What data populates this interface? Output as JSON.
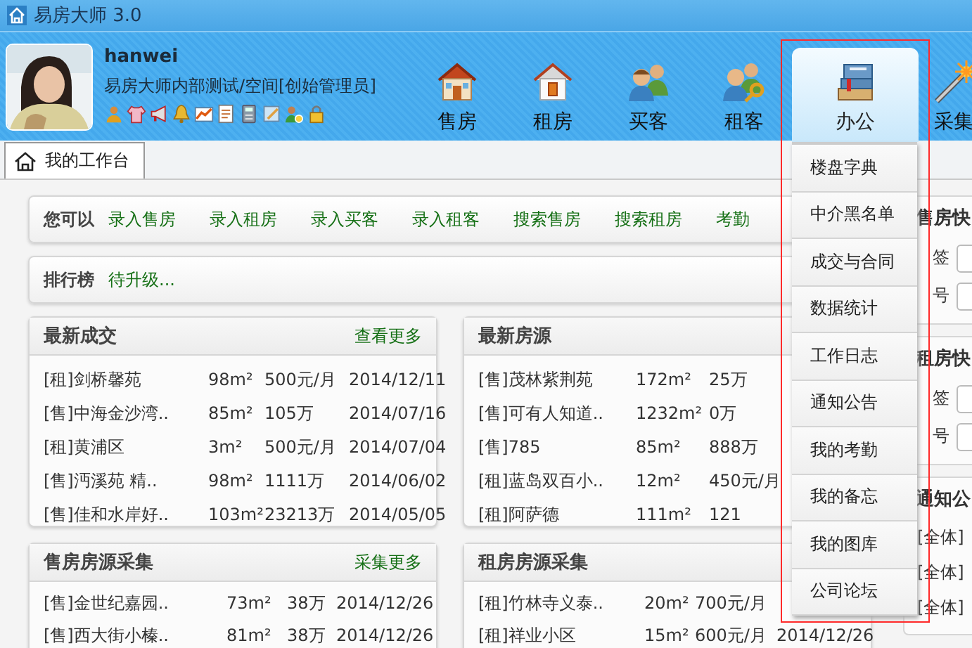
{
  "window": {
    "title": "易房大师 3.0"
  },
  "user": {
    "name": "hanwei",
    "org": "易房大师内部测试/空间[创始管理员]"
  },
  "nav": [
    {
      "label": "售房",
      "selected": false
    },
    {
      "label": "租房",
      "selected": false
    },
    {
      "label": "买客",
      "selected": false
    },
    {
      "label": "租客",
      "selected": false
    },
    {
      "label": "办公",
      "selected": true
    },
    {
      "label": "采集",
      "selected": false
    }
  ],
  "tabs": [
    {
      "label": "我的工作台",
      "selected": true
    }
  ],
  "quick_actions": {
    "label": "您可以",
    "links": [
      "录入售房",
      "录入租房",
      "录入买客",
      "录入租客",
      "搜索售房",
      "搜索租房",
      "考勤"
    ]
  },
  "ranking": {
    "label": "排行榜",
    "value": "待升级..."
  },
  "cards": [
    {
      "title": "最新成交",
      "more": "查看更多",
      "rows": [
        [
          "[租]剑桥馨苑",
          "98m²",
          "500元/月",
          "2014/12/11"
        ],
        [
          "[售]中海金沙湾..",
          "85m²",
          "105万",
          "2014/07/16"
        ],
        [
          "[租]黄浦区",
          "3m²",
          "500元/月",
          "2014/07/04"
        ],
        [
          "[售]沔溪苑 精..",
          "98m²",
          "1111万",
          "2014/06/02"
        ],
        [
          "[售]佳和水岸好..",
          "103m²",
          "23213万",
          "2014/05/05"
        ]
      ]
    },
    {
      "title": "最新房源",
      "rows": [
        [
          "[售]茂林紫荆苑",
          "172m²",
          "25万"
        ],
        [
          "[售]可有人知道..",
          "1232m²",
          "0万"
        ],
        [
          "[售]785",
          "85m²",
          "888万"
        ],
        [
          "[租]蓝岛双百小..",
          "12m²",
          "450元/月"
        ],
        [
          "[租]阿萨德",
          "111m²",
          "121"
        ]
      ]
    },
    {
      "title": "售房房源采集",
      "more": "采集更多",
      "rows": [
        [
          "[售]金世纪嘉园..",
          "73m²",
          "38万",
          "2014/12/26"
        ],
        [
          "[售]西大街小榛..",
          "81m²",
          "38万",
          "2014/12/26"
        ]
      ]
    },
    {
      "title": "租房房源采集",
      "rows": [
        [
          "[租]竹林寺义泰..",
          "20m²",
          "700元/月"
        ],
        [
          "[租]祥业小区",
          "15m²",
          "600元/月",
          "2014/12/26"
        ]
      ]
    }
  ],
  "side_cards": [
    {
      "title": "售房快",
      "fields": [
        "签",
        "号"
      ]
    },
    {
      "title": "租房快",
      "fields": [
        "签",
        "号"
      ]
    },
    {
      "title": "通知公",
      "items": [
        "[全体]",
        "[全体]",
        "[全体]"
      ]
    }
  ],
  "menu": {
    "items": [
      "楼盘字典",
      "中介黑名单",
      "成交与合同",
      "数据统计",
      "工作日志",
      "通知公告",
      "我的考勤",
      "我的备忘",
      "我的图库",
      "公司论坛"
    ]
  }
}
